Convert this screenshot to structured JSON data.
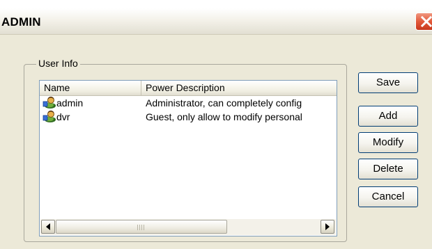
{
  "window": {
    "title": "ADMIN"
  },
  "group": {
    "legend": "User Info"
  },
  "list": {
    "columns": [
      "Name",
      "Power Description"
    ],
    "rows": [
      {
        "name": "admin",
        "description": "Administrator, can completely config",
        "icon": "user-icon"
      },
      {
        "name": "dvr",
        "description": "Guest, only allow to modify personal",
        "icon": "user-icon"
      }
    ],
    "scrollbar": {
      "thumb_position": 0
    }
  },
  "buttons": {
    "save": "Save",
    "add": "Add",
    "modify": "Modify",
    "delete": "Delete",
    "cancel": "Cancel"
  },
  "colors": {
    "close_button": "#e2593a",
    "list_border": "#7f9db9",
    "dialog_bg": "#ece9d8"
  }
}
